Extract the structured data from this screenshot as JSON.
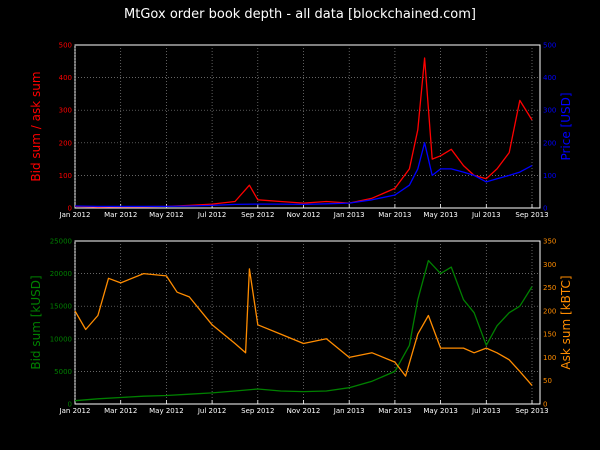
{
  "chart_data": [
    {
      "type": "line",
      "title": "MtGox order book depth - all data  [blockchained.com]",
      "x_ticks": [
        "Jan 2012",
        "Mar 2012",
        "May 2012",
        "Jul 2012",
        "Sep 2012",
        "Nov 2012",
        "Jan 2013",
        "Mar 2013",
        "May 2013",
        "Jul 2013",
        "Sep 2013"
      ],
      "xlim": [
        "2012-01",
        "2013-09"
      ],
      "ylabel_left": "Bid sum / ask sum",
      "ylabel_right": "Price [USD]",
      "ylim_left": [
        0,
        500
      ],
      "ylim_right": [
        0,
        500
      ],
      "yticks_left": [
        "0",
        "100",
        "200",
        "300",
        "400",
        "500"
      ],
      "yticks_right": [
        "0",
        "100",
        "200",
        "300",
        "400",
        "500"
      ],
      "grid": true,
      "colors": {
        "left": "#ff0000",
        "right": "#0000ff"
      },
      "series": [
        {
          "axis": "left",
          "x": [
            "2012-01",
            "2012-02",
            "2012-03",
            "2012-04",
            "2012-05",
            "2012-06",
            "2012-07",
            "2012-08",
            "2012-08-20",
            "2012-09",
            "2012-10",
            "2012-11",
            "2012-12",
            "2013-01",
            "2013-02",
            "2013-03",
            "2013-03-20",
            "2013-04",
            "2013-04-10",
            "2013-04-20",
            "2013-05",
            "2013-05-15",
            "2013-06",
            "2013-06-15",
            "2013-07",
            "2013-07-15",
            "2013-08",
            "2013-08-15",
            "2013-09"
          ],
          "values": [
            5,
            3,
            4,
            4,
            5,
            8,
            12,
            20,
            70,
            25,
            20,
            15,
            20,
            15,
            30,
            60,
            120,
            240,
            460,
            150,
            160,
            180,
            130,
            100,
            90,
            120,
            170,
            330,
            270
          ]
        },
        {
          "axis": "right",
          "x": [
            "2012-01",
            "2012-02",
            "2012-03",
            "2012-04",
            "2012-05",
            "2012-06",
            "2012-07",
            "2012-08",
            "2012-09",
            "2012-10",
            "2012-11",
            "2012-12",
            "2013-01",
            "2013-02",
            "2013-03",
            "2013-03-20",
            "2013-04",
            "2013-04-10",
            "2013-04-20",
            "2013-05",
            "2013-05-15",
            "2013-06",
            "2013-06-15",
            "2013-07",
            "2013-07-15",
            "2013-08",
            "2013-08-15",
            "2013-09"
          ],
          "values": [
            6,
            5,
            5,
            5,
            5,
            6,
            8,
            11,
            12,
            12,
            11,
            13,
            15,
            25,
            40,
            70,
            120,
            200,
            100,
            120,
            120,
            110,
            100,
            80,
            90,
            100,
            110,
            130
          ]
        }
      ]
    },
    {
      "type": "line",
      "x_ticks": [
        "Jan 2012",
        "Mar 2012",
        "May 2012",
        "Jul 2012",
        "Sep 2012",
        "Nov 2012",
        "Jan 2013",
        "Mar 2013",
        "May 2013",
        "Jul 2013",
        "Sep 2013"
      ],
      "xlim": [
        "2012-01",
        "2013-09"
      ],
      "ylabel_left": "Bid sum [kUSD]",
      "ylabel_right": "Ask sum [kBTC]",
      "ylim_left": [
        0,
        25000
      ],
      "ylim_right": [
        0,
        350
      ],
      "yticks_left": [
        "0",
        "5000",
        "10000",
        "15000",
        "20000",
        "25000"
      ],
      "yticks_right": [
        "0",
        "50",
        "100",
        "150",
        "200",
        "250",
        "300",
        "350"
      ],
      "grid": true,
      "colors": {
        "left": "#008000",
        "right": "#ff8c00"
      },
      "series": [
        {
          "axis": "left",
          "x": [
            "2012-01",
            "2012-02",
            "2012-03",
            "2012-04",
            "2012-05",
            "2012-06",
            "2012-07",
            "2012-08",
            "2012-09",
            "2012-10",
            "2012-11",
            "2012-12",
            "2013-01",
            "2013-02",
            "2013-03",
            "2013-03-20",
            "2013-04",
            "2013-04-15",
            "2013-05",
            "2013-05-15",
            "2013-06",
            "2013-06-15",
            "2013-07",
            "2013-07-15",
            "2013-08",
            "2013-08-15",
            "2013-09"
          ],
          "values": [
            500,
            800,
            1000,
            1200,
            1300,
            1500,
            1700,
            2000,
            2300,
            2000,
            1900,
            2000,
            2500,
            3500,
            5000,
            9000,
            16000,
            22000,
            20000,
            21000,
            16000,
            14000,
            9000,
            12000,
            14000,
            15000,
            18000
          ]
        },
        {
          "axis": "right",
          "x": [
            "2012-01",
            "2012-01-15",
            "2012-02",
            "2012-02-15",
            "2012-03",
            "2012-04",
            "2012-05",
            "2012-05-15",
            "2012-06",
            "2012-07",
            "2012-08",
            "2012-08-15",
            "2012-08-20",
            "2012-09",
            "2012-10",
            "2012-11",
            "2012-12",
            "2013-01",
            "2013-02",
            "2013-03",
            "2013-03-15",
            "2013-04",
            "2013-04-15",
            "2013-05",
            "2013-06",
            "2013-06-15",
            "2013-07",
            "2013-07-15",
            "2013-08",
            "2013-08-15",
            "2013-09"
          ],
          "values": [
            200,
            160,
            190,
            270,
            260,
            280,
            275,
            240,
            230,
            170,
            130,
            110,
            290,
            170,
            150,
            130,
            140,
            100,
            110,
            90,
            60,
            150,
            190,
            120,
            120,
            110,
            120,
            110,
            95,
            70,
            40
          ]
        }
      ]
    }
  ]
}
